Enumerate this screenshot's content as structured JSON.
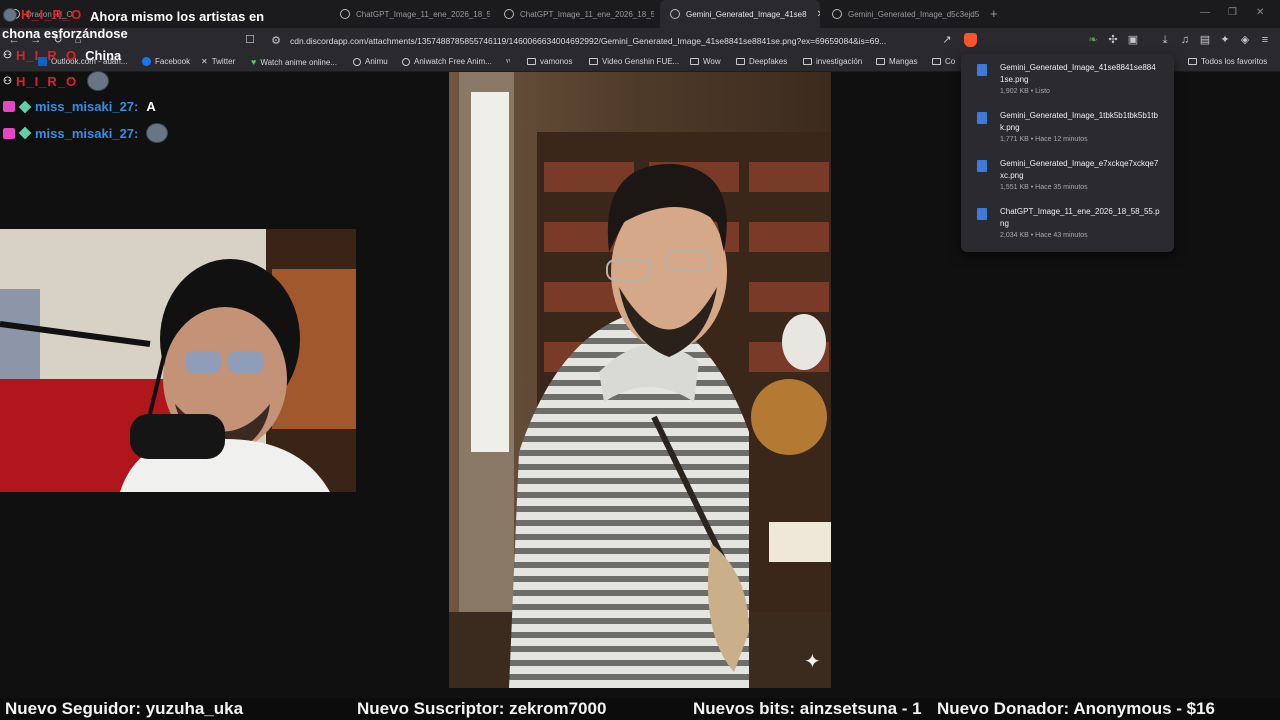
{
  "browser": {
    "tabs": [
      {
        "label": "Dracon_H_O",
        "active": false
      },
      {
        "label": "ChatGPT_Image_11_ene_2026_18_58",
        "active": false
      },
      {
        "label": "ChatGPT_Image_11_ene_2026_18_58",
        "active": false
      },
      {
        "label": "Gemini_Generated_Image_41se8",
        "active": true
      },
      {
        "label": "Gemini_Generated_Image_d5c3ejd5",
        "active": false
      }
    ],
    "new_tab_symbol": "+",
    "url": "cdn.discordapp.com/attachments/1357488785855746119/1460066634004692992/Gemini_Generated_Image_41se8841se8841se.png?ex=69659084&is=69...",
    "bookmarks": [
      {
        "label": "Outlook.com - adan...",
        "icon": "outlook-icon"
      },
      {
        "label": "Facebook",
        "icon": "facebook-icon"
      },
      {
        "label": "Twitter",
        "icon": "x-icon"
      },
      {
        "label": "Watch anime online...",
        "icon": "heart-icon"
      },
      {
        "label": "Animu",
        "icon": "globe-icon"
      },
      {
        "label": "Aniwatch Free Anim...",
        "icon": "globe-icon"
      },
      {
        "label": "vamonos",
        "icon": "folder-icon"
      },
      {
        "label": "Video Genshin FUE...",
        "icon": "folder-icon"
      },
      {
        "label": "Wow",
        "icon": "folder-icon"
      },
      {
        "label": "Deepfakes",
        "icon": "folder-icon"
      },
      {
        "label": "investigación",
        "icon": "folder-icon"
      },
      {
        "label": "Mangas",
        "icon": "folder-icon"
      },
      {
        "label": "Co",
        "icon": "folder-icon"
      }
    ],
    "all_bookmarks_label": "Todos los favoritos"
  },
  "downloads": [
    {
      "name": "Gemini_Generated_Image_41se8841se8841se.png",
      "meta": "1,902 KB • Listo"
    },
    {
      "name": "Gemini_Generated_Image_1tbk5b1tbk5b1tbk.png",
      "meta": "1,771 KB • Hace 12 minutos"
    },
    {
      "name": "Gemini_Generated_Image_e7xckqe7xckqe7xc.png",
      "meta": "1,551 KB • Hace 35 minutos"
    },
    {
      "name": "ChatGPT_Image_11_ene_2026_18_58_55.png",
      "meta": "2,034 KB • Hace 43 minutos"
    }
  ],
  "chat": [
    {
      "user": "H_I_R_O",
      "message": "Ahora mismo los artistas en chona esforzándose",
      "color": "#e0202a"
    },
    {
      "user": "H_I_R_O",
      "message": "China",
      "color": "#e0202a"
    },
    {
      "user": "H_I_R_O",
      "message": "",
      "emote": true,
      "color": "#e0202a"
    },
    {
      "user": "miss_misaki_27:",
      "message": "A",
      "color": "#2f8ee8"
    },
    {
      "user": "miss_misaki_27:",
      "message": "",
      "emote": true,
      "color": "#2f8ee8"
    }
  ],
  "alerts": {
    "follower": "Nuevo Seguidor: yuzuha_uka",
    "subscriber": "Nuevo Suscriptor: zekrom7000",
    "bits": "Nuevos bits: ainzsetsuna - 1",
    "donor": "Nuevo Donador: Anonymous - $16"
  },
  "colors": {
    "accent_red": "#e0202a",
    "accent_blue": "#2f8ee8",
    "brave": "#fb542b"
  }
}
